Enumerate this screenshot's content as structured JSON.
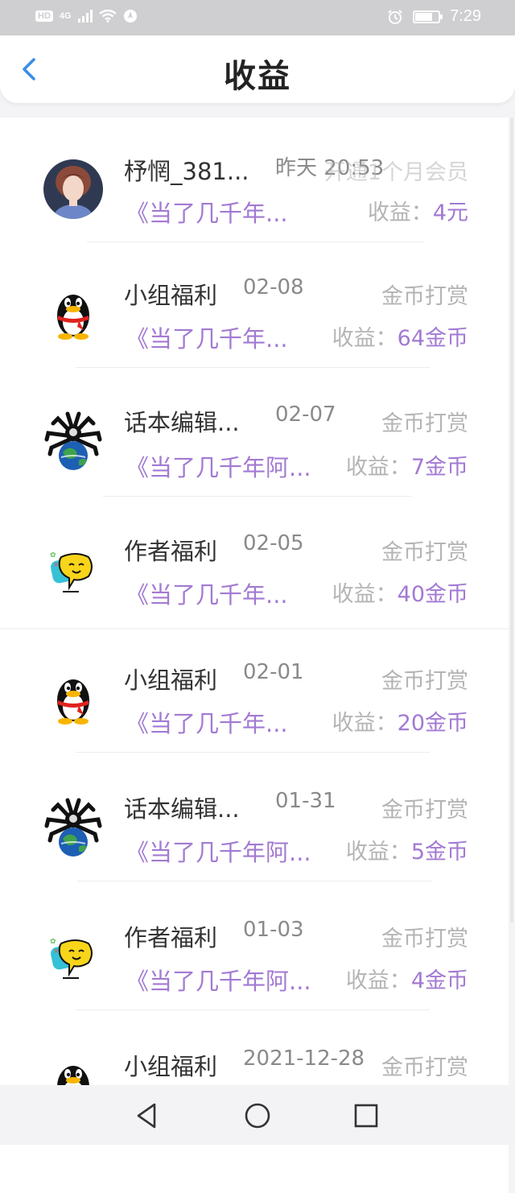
{
  "status_bar": {
    "hd_chip": "HD",
    "network": "4G",
    "time": "7:29",
    "battery_percent": 75
  },
  "header": {
    "title": "收益"
  },
  "income_label": "收益：",
  "items": [
    {
      "name": "杼惘_381...",
      "time": "昨天 20:53",
      "type": "开通1个月会员",
      "book": "《当了几千年...",
      "amount": "4元",
      "avatar": "photo-avatar"
    },
    {
      "name": "小组福利",
      "time": "02-08",
      "type": "金币打赏",
      "book": "《当了几千年...",
      "amount": "64金币",
      "avatar": "penguin-icon"
    },
    {
      "name": "话本编辑...",
      "time": "02-07",
      "type": "金币打赏",
      "book": "《当了几千年阿...",
      "amount": "7金币",
      "avatar": "globe-spider-icon"
    },
    {
      "name": "作者福利",
      "time": "02-05",
      "type": "金币打赏",
      "book": "《当了几千年...",
      "amount": "40金币",
      "avatar": "speech-bubble-icon"
    },
    {
      "name": "小组福利",
      "time": "02-01",
      "type": "金币打赏",
      "book": "《当了几千年...",
      "amount": "20金币",
      "avatar": "penguin-icon"
    },
    {
      "name": "话本编辑...",
      "time": "01-31",
      "type": "金币打赏",
      "book": "《当了几千年阿...",
      "amount": "5金币",
      "avatar": "globe-spider-icon"
    },
    {
      "name": "作者福利",
      "time": "01-03",
      "type": "金币打赏",
      "book": "《当了几千年阿...",
      "amount": "4金币",
      "avatar": "speech-bubble-icon"
    },
    {
      "name": "小组福利",
      "time": "2021-12-28",
      "type": "金币打赏",
      "avatar": "penguin-icon"
    }
  ]
}
